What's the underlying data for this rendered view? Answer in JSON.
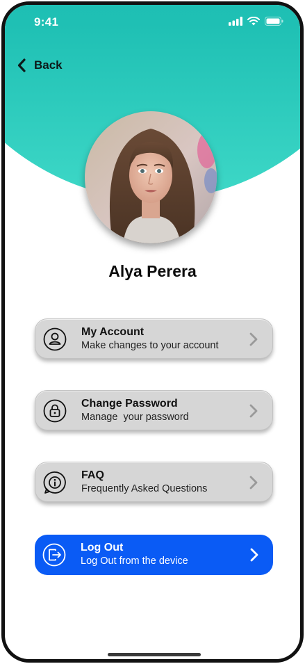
{
  "status_bar": {
    "time": "9:41",
    "icons": [
      "signal-icon",
      "wifi-icon",
      "battery-icon"
    ]
  },
  "header": {
    "back_label": "Back",
    "back_icon": "chevron-left-icon"
  },
  "profile": {
    "name": "Alya Perera",
    "avatar_icon": "profile-photo"
  },
  "menu": {
    "items": [
      {
        "title": "My Account",
        "subtitle": "Make changes to your account",
        "icon": "user-icon"
      },
      {
        "title": "Change Password",
        "subtitle": "Manage  your password",
        "icon": "lock-icon"
      },
      {
        "title": "FAQ",
        "subtitle": "Frequently Asked Questions",
        "icon": "info-icon"
      }
    ],
    "logout": {
      "title": "Log Out",
      "subtitle": "Log Out from the device",
      "icon": "logout-icon"
    }
  },
  "colors": {
    "header_gradient_top": "#14aaa6",
    "header_gradient_bottom": "#3ed8c7",
    "menu_background": "#d6d6d6",
    "logout_background": "#0a5bf5"
  }
}
